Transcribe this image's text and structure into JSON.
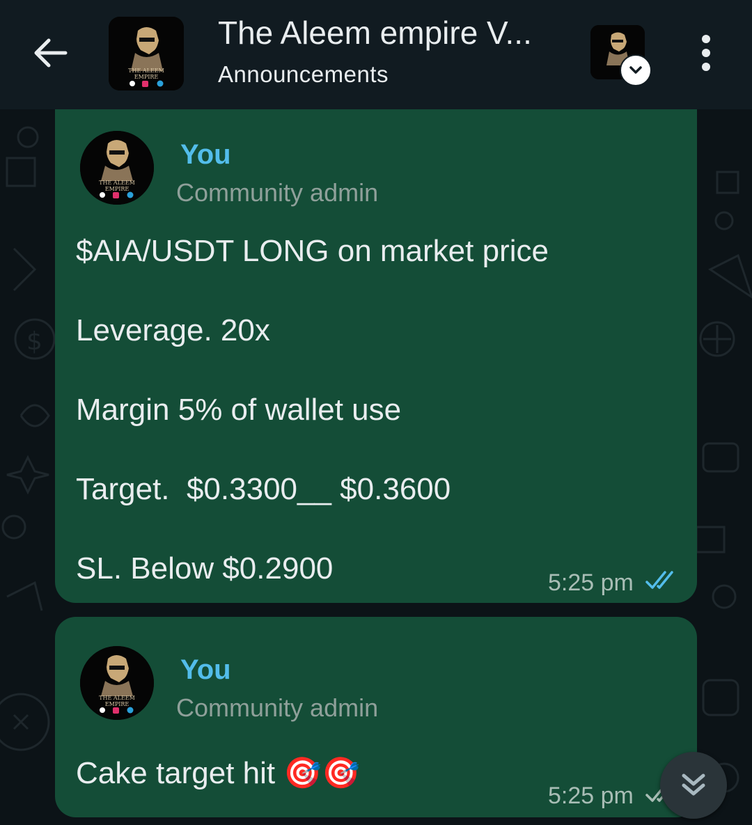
{
  "header": {
    "title": "The Aleem empire V...",
    "subtitle": "Announcements",
    "avatar_caption": "THE ALEEM EMPIRE"
  },
  "messages": [
    {
      "sender": "You",
      "role": "Community admin",
      "lines": [
        "$AIA/USDT LONG on market price",
        "Leverage. 20x",
        "Margin 5% of wallet use",
        "Target.  $0.3300__ $0.3600",
        "SL. Below $0.2900"
      ],
      "time": "5:25 pm",
      "status_icon": "double-check-read-icon"
    },
    {
      "sender": "You",
      "role": "Community admin",
      "lines": [
        "Cake target hit 🎯🎯"
      ],
      "time": "5:25 pm",
      "status_icon": "double-check-icon"
    }
  ],
  "colors": {
    "header_bg": "#111b21",
    "bubble_outgoing": "#144d37",
    "sender_name": "#53bdeb",
    "read_tick": "#53bdeb"
  }
}
